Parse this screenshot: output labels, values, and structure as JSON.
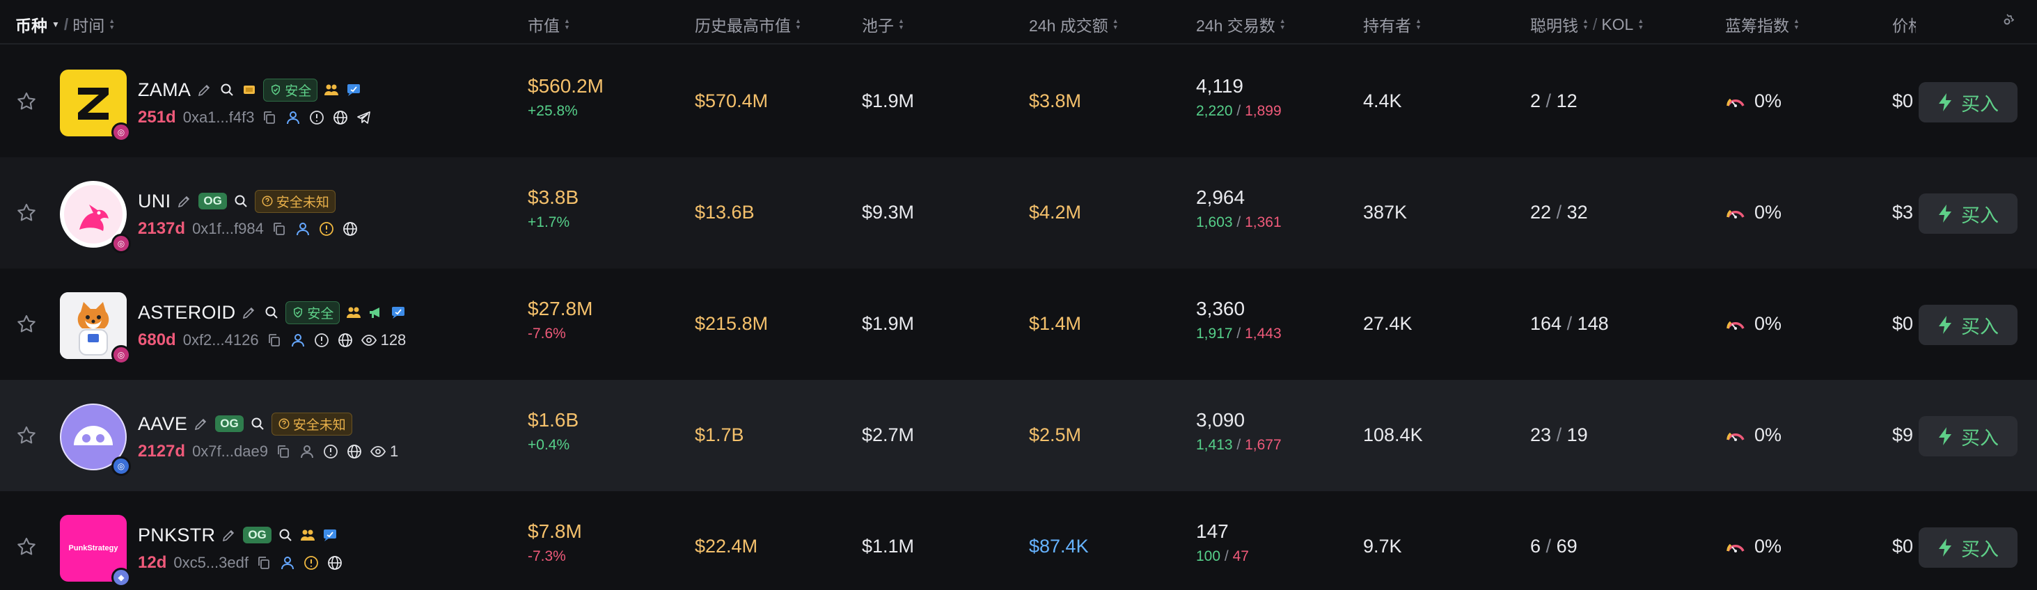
{
  "header": {
    "coin": "币种",
    "time": "时间",
    "market_cap": "市值",
    "ath_market_cap": "历史最高市值",
    "pool": "池子",
    "volume_24h": "24h 成交额",
    "tx_24h": "24h 交易数",
    "holders": "持有者",
    "smart_money": "聪明钱",
    "kol": "KOL",
    "bluechip": "蓝筹指数",
    "price": "价格"
  },
  "rows": [
    {
      "symbol": "ZAMA",
      "age": "251d",
      "address": "0xa1...f4f3",
      "og": "",
      "safety": "安全",
      "viewers": "",
      "market_cap": "$560.2M",
      "change": "+25.8%",
      "ath": "$570.4M",
      "pool": "$1.9M",
      "volume": "$3.8M",
      "tx": "4,119",
      "buys": "2,220",
      "sells": "1,899",
      "holders": "4.4K",
      "smart": "2",
      "kol": "12",
      "bluechip": "0%",
      "price": "$0",
      "buy_label": "买入"
    },
    {
      "symbol": "UNI",
      "age": "2137d",
      "address": "0x1f...f984",
      "og": "OG",
      "safety": "安全未知",
      "viewers": "",
      "market_cap": "$3.8B",
      "change": "+1.7%",
      "ath": "$13.6B",
      "pool": "$9.3M",
      "volume": "$4.2M",
      "tx": "2,964",
      "buys": "1,603",
      "sells": "1,361",
      "holders": "387K",
      "smart": "22",
      "kol": "32",
      "bluechip": "0%",
      "price": "$3",
      "buy_label": "买入"
    },
    {
      "symbol": "ASTEROID",
      "age": "680d",
      "address": "0xf2...4126",
      "og": "",
      "safety": "安全",
      "viewers": "128",
      "market_cap": "$27.8M",
      "change": "-7.6%",
      "ath": "$215.8M",
      "pool": "$1.9M",
      "volume": "$1.4M",
      "tx": "3,360",
      "buys": "1,917",
      "sells": "1,443",
      "holders": "27.4K",
      "smart": "164",
      "kol": "148",
      "bluechip": "0%",
      "price": "$0",
      "buy_label": "买入"
    },
    {
      "symbol": "AAVE",
      "age": "2127d",
      "address": "0x7f...dae9",
      "og": "OG",
      "safety": "安全未知",
      "viewers": "1",
      "market_cap": "$1.6B",
      "change": "+0.4%",
      "ath": "$1.7B",
      "pool": "$2.7M",
      "volume": "$2.5M",
      "tx": "3,090",
      "buys": "1,413",
      "sells": "1,677",
      "holders": "108.4K",
      "smart": "23",
      "kol": "19",
      "bluechip": "0%",
      "price": "$9",
      "buy_label": "买入"
    },
    {
      "symbol": "PNKSTR",
      "age": "12d",
      "address": "0xc5...3edf",
      "og": "OG",
      "safety": "",
      "viewers": "",
      "market_cap": "$7.8M",
      "change": "-7.3%",
      "ath": "$22.4M",
      "pool": "$1.1M",
      "volume": "$87.4K",
      "tx": "147",
      "buys": "100",
      "sells": "47",
      "holders": "9.7K",
      "smart": "6",
      "kol": "69",
      "bluechip": "0%",
      "price": "$0",
      "buy_label": "买入",
      "logo_text": "PunkStrategy"
    }
  ],
  "colors": {
    "accent_green": "#56d08a",
    "accent_red": "#ef5a7a",
    "gold": "#f5c16c",
    "blue": "#66b3ff"
  }
}
